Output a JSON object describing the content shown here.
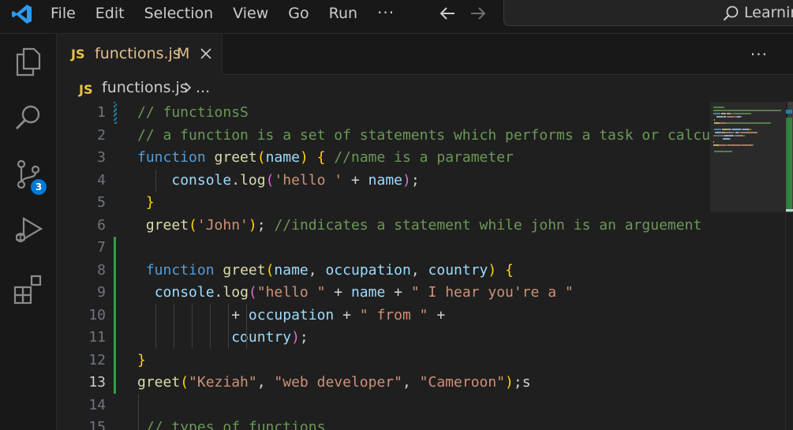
{
  "menu": {
    "items": [
      "File",
      "Edit",
      "Selection",
      "View",
      "Go",
      "Run"
    ],
    "more": "···"
  },
  "search": {
    "text": "Learning"
  },
  "activity": {
    "source_control_badge": "3"
  },
  "tab": {
    "lang": "JS",
    "filename": "functions.js",
    "status": "M"
  },
  "editor_more": "···",
  "breadcrumb": {
    "lang": "JS",
    "file": "functions.js",
    "rest": "..."
  },
  "editor": {
    "active_line": 13,
    "lines": [
      {
        "n": "1",
        "segs": [
          [
            "c-com",
            "// functionsS"
          ]
        ]
      },
      {
        "n": "2",
        "segs": [
          [
            "c-com",
            "// a function is a set of statements which performs a task or calculates a value"
          ]
        ]
      },
      {
        "n": "3",
        "segs": [
          [
            "c-kw",
            "function"
          ],
          [
            "c-pl",
            " "
          ],
          [
            "c-fn",
            "greet"
          ],
          [
            "c-b1",
            "("
          ],
          [
            "c-var",
            "name"
          ],
          [
            "c-b1",
            ")"
          ],
          [
            "c-pl",
            " "
          ],
          [
            "c-b1",
            "{"
          ],
          [
            "c-pl",
            " "
          ],
          [
            "c-com",
            "//name is a parameter"
          ]
        ]
      },
      {
        "n": "4",
        "segs": [
          [
            "c-pl",
            "    "
          ],
          [
            "c-var",
            "console"
          ],
          [
            "c-pl",
            "."
          ],
          [
            "c-fn",
            "log"
          ],
          [
            "c-b2",
            "("
          ],
          [
            "c-str",
            "'hello '"
          ],
          [
            "c-pl",
            " + "
          ],
          [
            "c-var",
            "name"
          ],
          [
            "c-b2",
            ")"
          ],
          [
            "c-pl",
            ";"
          ]
        ]
      },
      {
        "n": "5",
        "segs": [
          [
            "c-pl",
            " "
          ],
          [
            "c-b1",
            "}"
          ]
        ]
      },
      {
        "n": "6",
        "segs": [
          [
            "c-pl",
            " "
          ],
          [
            "c-fn",
            "greet"
          ],
          [
            "c-b1",
            "("
          ],
          [
            "c-str",
            "'John'"
          ],
          [
            "c-b1",
            ")"
          ],
          [
            "c-pl",
            "; "
          ],
          [
            "c-com",
            "//indicates a statement while john is an arguement"
          ]
        ]
      },
      {
        "n": "7",
        "segs": []
      },
      {
        "n": "8",
        "segs": [
          [
            "c-pl",
            " "
          ],
          [
            "c-kw",
            "function"
          ],
          [
            "c-pl",
            " "
          ],
          [
            "c-fn",
            "greet"
          ],
          [
            "c-b1",
            "("
          ],
          [
            "c-var",
            "name"
          ],
          [
            "c-pl",
            ", "
          ],
          [
            "c-var",
            "occupation"
          ],
          [
            "c-pl",
            ", "
          ],
          [
            "c-var",
            "country"
          ],
          [
            "c-b1",
            ")"
          ],
          [
            "c-pl",
            " "
          ],
          [
            "c-b1",
            "{"
          ]
        ]
      },
      {
        "n": "9",
        "segs": [
          [
            "c-pl",
            "  "
          ],
          [
            "c-var",
            "console"
          ],
          [
            "c-pl",
            "."
          ],
          [
            "c-fn",
            "log"
          ],
          [
            "c-b2",
            "("
          ],
          [
            "c-str",
            "\"hello \""
          ],
          [
            "c-pl",
            " + "
          ],
          [
            "c-var",
            "name"
          ],
          [
            "c-pl",
            " + "
          ],
          [
            "c-str",
            "\" I hear you're a \""
          ]
        ]
      },
      {
        "n": "10",
        "segs": [
          [
            "c-pl",
            "           + "
          ],
          [
            "c-var",
            "occupation"
          ],
          [
            "c-pl",
            " + "
          ],
          [
            "c-str",
            "\" from \""
          ],
          [
            "c-pl",
            " +"
          ]
        ]
      },
      {
        "n": "11",
        "segs": [
          [
            "c-pl",
            "           "
          ],
          [
            "c-var",
            "country"
          ],
          [
            "c-b2",
            ")"
          ],
          [
            "c-pl",
            ";"
          ]
        ]
      },
      {
        "n": "12",
        "segs": [
          [
            "c-b1",
            "}"
          ]
        ]
      },
      {
        "n": "13",
        "segs": [
          [
            "c-fn",
            "greet"
          ],
          [
            "c-b1",
            "("
          ],
          [
            "c-str",
            "\"Keziah\""
          ],
          [
            "c-pl",
            ", "
          ],
          [
            "c-str",
            "\"web developer\""
          ],
          [
            "c-pl",
            ", "
          ],
          [
            "c-str",
            "\"Cameroon\""
          ],
          [
            "c-b1",
            ")"
          ],
          [
            "c-pl",
            ";s"
          ]
        ]
      },
      {
        "n": "14",
        "segs": []
      },
      {
        "n": "15",
        "segs": [
          [
            "c-pl",
            " "
          ],
          [
            "c-com",
            "// types of functions"
          ]
        ]
      }
    ]
  },
  "colors": {
    "accent": "#0078d4",
    "modified": "#2ea043",
    "js_badge": "#e8c546"
  }
}
